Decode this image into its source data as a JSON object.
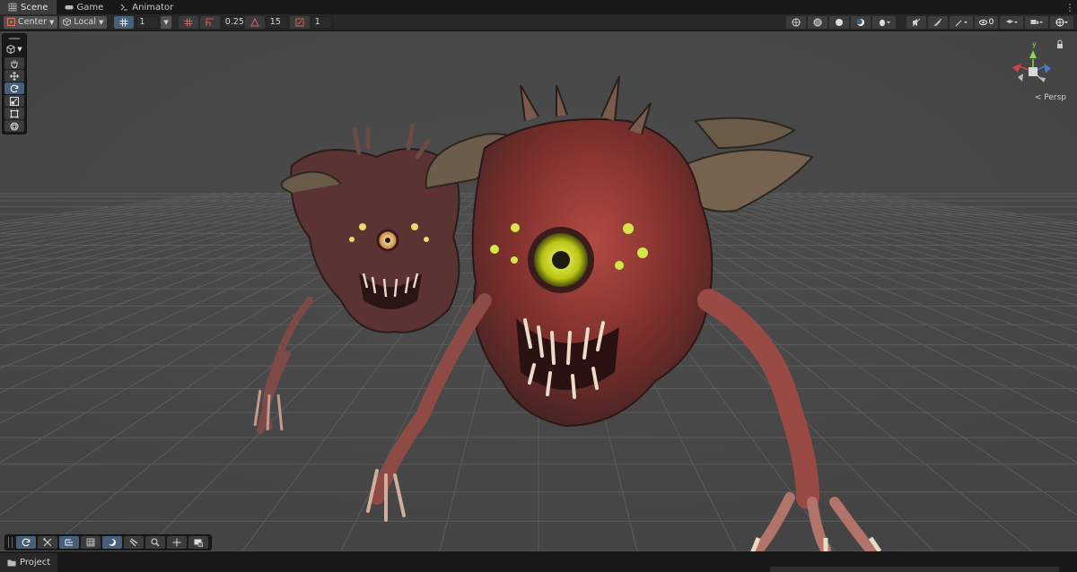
{
  "tabs": [
    {
      "label": "Scene",
      "icon": "grid-icon",
      "active": true
    },
    {
      "label": "Game",
      "icon": "gamepad-icon",
      "active": false
    },
    {
      "label": "Animator",
      "icon": "animator-icon",
      "active": false
    }
  ],
  "toolbar": {
    "pivot_label": "Center",
    "space_label": "Local",
    "grid_size_value": "1",
    "snap_increment_value": "0.25",
    "rotate_snap_value": "15",
    "scale_snap_value": "1"
  },
  "viewport": {
    "projection_label": "< Persp",
    "axis_y_label": "y",
    "visible_count": "0"
  },
  "bottom": {
    "project_tab_label": "Project"
  },
  "colors": {
    "accent": "#46607c",
    "viewport_bg": "#474747",
    "panel_bg": "#191919"
  }
}
